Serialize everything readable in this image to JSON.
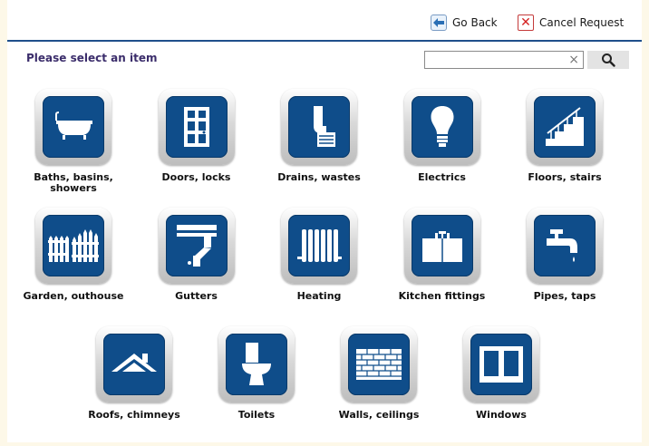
{
  "toolbar": {
    "go_back_label": "Go Back",
    "cancel_label": "Cancel Request"
  },
  "prompt": "Please select an item",
  "search": {
    "value": "",
    "placeholder": "",
    "clear_glyph": "×"
  },
  "colors": {
    "tile_blue": "#0f4d8a",
    "rule_blue": "#1f4f8b",
    "prompt_purple": "#3b2d6b",
    "background": "#fdf8e8"
  },
  "items": [
    {
      "label": "Baths, basins, showers",
      "icon": "bath-icon"
    },
    {
      "label": "Doors, locks",
      "icon": "door-icon"
    },
    {
      "label": "Drains, wastes",
      "icon": "drain-icon"
    },
    {
      "label": "Electrics",
      "icon": "lightbulb-icon"
    },
    {
      "label": "Floors, stairs",
      "icon": "stairs-icon"
    },
    {
      "label": "Garden, outhouse",
      "icon": "fence-icon"
    },
    {
      "label": "Gutters",
      "icon": "gutter-icon"
    },
    {
      "label": "Heating",
      "icon": "radiator-icon"
    },
    {
      "label": "Kitchen fittings",
      "icon": "sink-icon"
    },
    {
      "label": "Pipes, taps",
      "icon": "tap-icon"
    },
    {
      "label": "Roofs, chimneys",
      "icon": "roof-icon"
    },
    {
      "label": "Toilets",
      "icon": "toilet-icon"
    },
    {
      "label": "Walls, ceilings",
      "icon": "brick-wall-icon"
    },
    {
      "label": "Windows",
      "icon": "window-icon"
    }
  ]
}
